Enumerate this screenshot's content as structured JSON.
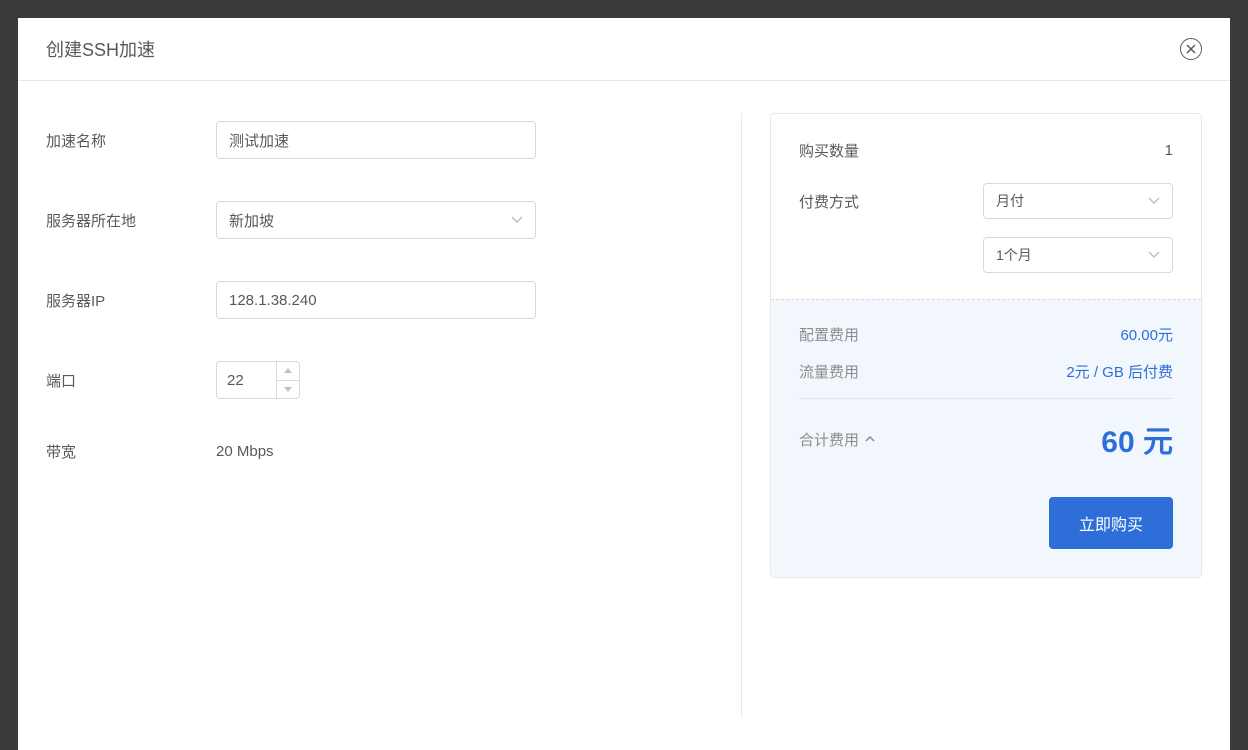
{
  "modal": {
    "title": "创建SSH加速"
  },
  "form": {
    "name_label": "加速名称",
    "name_value": "测试加速",
    "location_label": "服务器所在地",
    "location_value": "新加坡",
    "ip_label": "服务器IP",
    "ip_value": "128.1.38.240",
    "port_label": "端口",
    "port_value": "22",
    "bandwidth_label": "带宽",
    "bandwidth_value": "20 Mbps"
  },
  "purchase": {
    "quantity_label": "购买数量",
    "quantity_value": "1",
    "payment_label": "付费方式",
    "payment_method": "月付",
    "payment_duration": "1个月",
    "config_cost_label": "配置费用",
    "config_cost_value": "60.00元",
    "traffic_cost_label": "流量费用",
    "traffic_cost_value": "2元 / GB 后付费",
    "total_label": "合计费用",
    "total_value": "60 元",
    "buy_button": "立即购买"
  }
}
